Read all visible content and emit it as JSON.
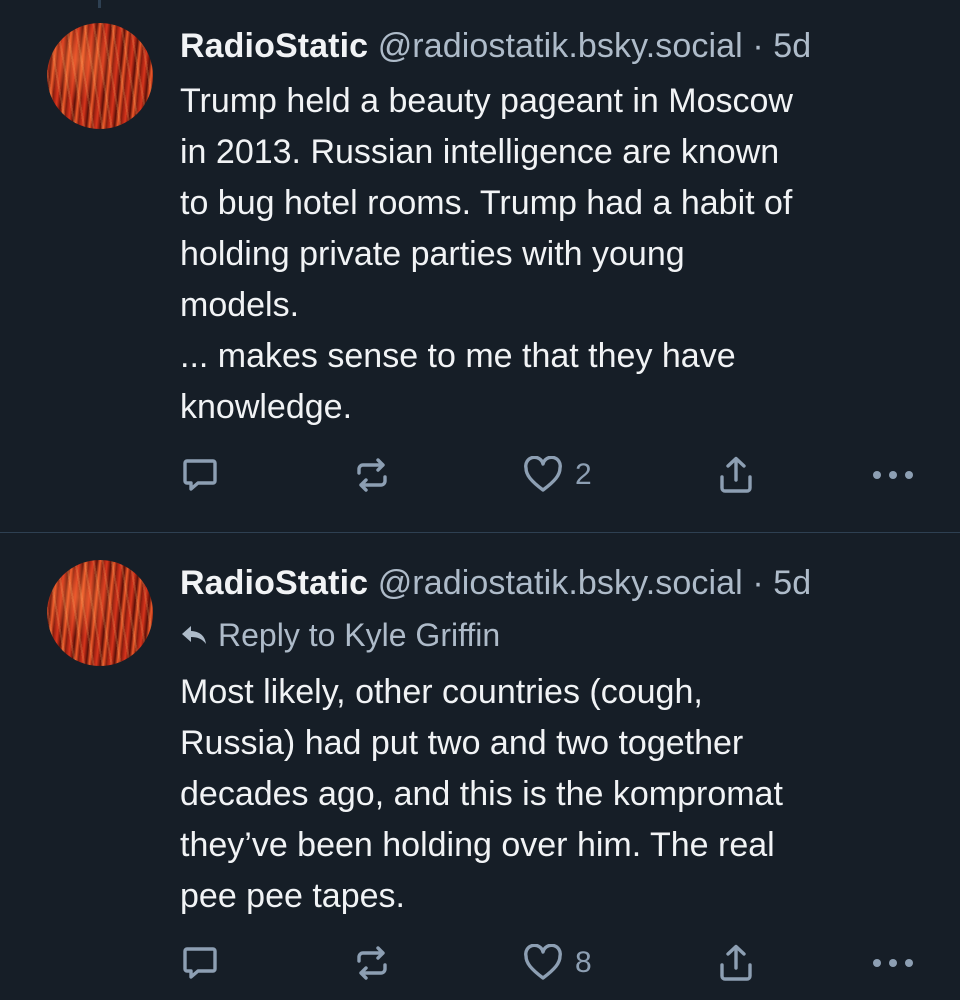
{
  "posts": [
    {
      "author": {
        "display_name": "RadioStatic",
        "handle": "@radiostatik.bsky.social"
      },
      "separator": "·",
      "time": "5d",
      "reply_to": null,
      "lines": [
        "Trump held a beauty pageant in Moscow",
        "in 2013. Russian intelligence are known",
        "to bug hotel rooms. Trump had a habit of",
        "holding private parties with young",
        "models.",
        "... makes sense to me that they have",
        "knowledge."
      ],
      "likes": "2"
    },
    {
      "author": {
        "display_name": "RadioStatic",
        "handle": "@radiostatik.bsky.social"
      },
      "separator": "·",
      "time": "5d",
      "reply_to": "Reply to Kyle Griffin",
      "lines": [
        "Most likely, other countries (cough,",
        "Russia) had put two and two together",
        "decades ago, and this is the kompromat",
        "they’ve been holding over him. The real",
        "pee pee tapes."
      ],
      "likes": "8"
    }
  ],
  "icons": {
    "reply": "reply-icon",
    "repost": "repost-icon",
    "like": "heart-icon",
    "share": "share-icon",
    "more": "more-icon",
    "reply_to": "reply-arrow-icon"
  },
  "colors": {
    "background": "#161e27",
    "text": "#f1f3f5",
    "secondary_text": "#aebbc9",
    "icon": "#8d9fb3",
    "divider": "#2e4052"
  }
}
